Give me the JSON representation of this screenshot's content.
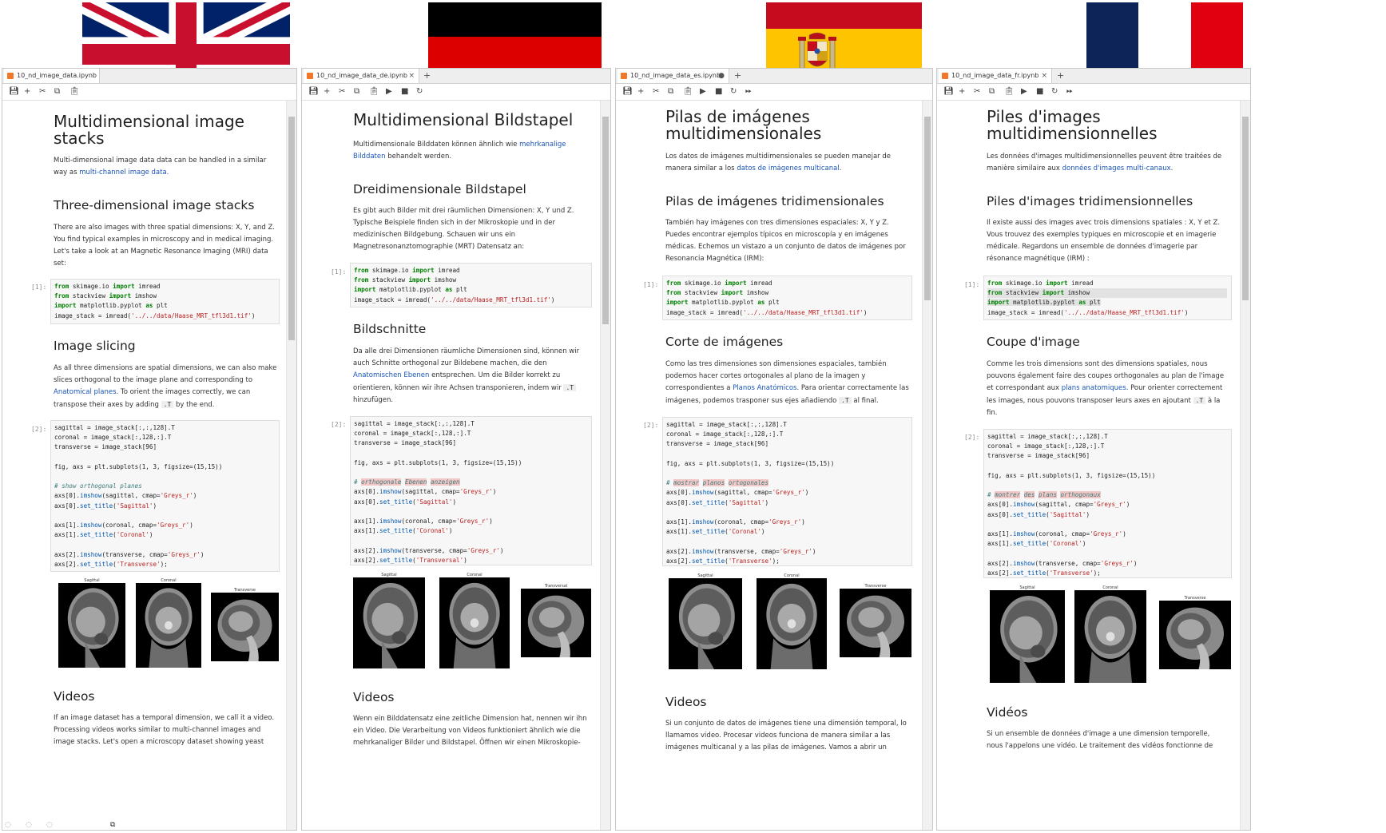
{
  "panels": {
    "en": {
      "tab_title": "10_nd_image_data.ipynb",
      "title": "Multidimensional image stacks",
      "intro": [
        "Multi-dimensional image data data can be handled in a similar",
        "way as "
      ],
      "intro_link": "multi-channel image data.",
      "h_3d": "Three-dimensional image stacks",
      "p_3d": [
        "There are also images with three spatial dimensions: X, Y, and Z.",
        "You find typical examples in microscopy and in medical imaging.",
        "Let's take a look at an Magnetic Resonance Imaging (MRI) data",
        "set:"
      ],
      "prompt1": "[1]:",
      "h_slicing": "Image slicing",
      "p_slicing": [
        "As all three dimensions are spatial dimensions, we can also make",
        "slices orthogonal to the image plane and corresponding to"
      ],
      "p_slicing_link": "Anatomical planes",
      "p_slicing_after": ". To orient the images correctly, we can",
      "p_slicing_end_pre": "transpose their axes by adding ",
      "p_slicing_code": ".T",
      "p_slicing_end_post": " by the end.",
      "prompt2": "[2]:",
      "comment": "# show orthogonal planes",
      "titles": [
        "Sagittal",
        "Coronal",
        "Transverse"
      ],
      "h_videos": "Videos",
      "p_videos": [
        "If an image dataset has a temporal dimension, we call it a video.",
        "Processing videos works similar to multi-channel images and",
        "image stacks. Let's open a microscopy dataset showing yeast"
      ]
    },
    "de": {
      "tab_title": "10_nd_image_data_de.ipynb",
      "title": "Multidimensional Bildstapel",
      "intro": [
        "Multidimensionale Bilddaten können ähnlich wie "
      ],
      "intro_link": "mehrkanalige",
      "intro_link2": "Bilddaten",
      "intro_end": " behandelt werden.",
      "h_3d": "Dreidimensionale Bildstapel",
      "p_3d": [
        "Es gibt auch Bilder mit drei räumlichen Dimensionen: X, Y und Z.",
        "Typische Beispiele finden sich in der Mikroskopie und in der",
        "medizinischen Bildgebung. Schauen wir uns ein",
        "Magnetresonanztomographie (MRT) Datensatz an:"
      ],
      "prompt1": "[1]:",
      "h_slicing": "Bildschnitte",
      "p_slicing": [
        "Da alle drei Dimensionen räumliche Dimensionen sind, können wir",
        "auch Schnitte orthogonal zur Bildebene machen, die den"
      ],
      "p_slicing_link": "Anatomischen Ebenen",
      "p_slicing_after": " entsprechen. Um die Bilder korrekt zu",
      "p_slicing_line4_pre": "orientieren, können wir ihre Achsen transponieren, indem wir ",
      "p_slicing_code": ".T",
      "p_slicing_end": "hinzufügen.",
      "prompt2": "[2]:",
      "comment_words": [
        "orthogonale",
        "Ebenen",
        "anzeigen"
      ],
      "titles": [
        "Sagittal",
        "Coronal",
        "Transversal"
      ],
      "h_videos": "Videos",
      "p_videos": [
        "Wenn ein Bilddatensatz eine zeitliche Dimension hat, nennen wir ihn",
        "ein Video. Die Verarbeitung von Videos funktioniert ähnlich wie die",
        "mehrkanaliger Bilder und Bildstapel. Öffnen wir einen Mikroskopie-"
      ]
    },
    "es": {
      "tab_title": "10_nd_image_data_es.ipynb",
      "title": [
        "Pilas de imágenes",
        "multidimensionales"
      ],
      "intro": [
        "Los datos de imágenes multidimensionales se pueden manejar de",
        "manera similar a los "
      ],
      "intro_link": "datos de imágenes multicanal",
      "intro_end": ".",
      "h_3d": "Pilas de imágenes tridimensionales",
      "p_3d": [
        "También hay imágenes con tres dimensiones espaciales: X, Y y Z.",
        "Puedes encontrar ejemplos típicos en microscopía y en imágenes",
        "médicas. Echemos un vistazo a un conjunto de datos de imágenes por",
        "Resonancia Magnética (IRM):"
      ],
      "prompt1": "[1]:",
      "h_slicing": "Corte de imágenes",
      "p_slicing": [
        "Como las tres dimensiones son dimensiones espaciales, también",
        "podemos hacer cortes ortogonales al plano de la imagen y"
      ],
      "p_slicing_pre": "correspondientes a ",
      "p_slicing_link": "Planos Anatómicos",
      "p_slicing_after": ". Para orientar correctamente las",
      "p_slicing_line4_pre": "imágenes, podemos trasponer sus ejes añadiendo ",
      "p_slicing_code": ".T",
      "p_slicing_line4_post": " al final.",
      "prompt2": "[2]:",
      "comment_words": [
        "mostrar",
        "planos",
        "ortogonales"
      ],
      "titles": [
        "Sagittal",
        "Coronal",
        "Transverse"
      ],
      "h_videos": "Videos",
      "p_videos": [
        "Si un conjunto de datos de imágenes tiene una dimensión temporal, lo",
        "llamamos video. Procesar videos funciona de manera similar a las",
        "imágenes multicanal y a las pilas de imágenes. Vamos a abrir un"
      ]
    },
    "fr": {
      "tab_title": "10_nd_image_data_fr.ipynb",
      "title": [
        "Piles d'images",
        "multidimensionnelles"
      ],
      "intro": [
        "Les données d'images multidimensionnelles peuvent être traitées de",
        "manière similaire aux "
      ],
      "intro_link": "données d'images multi-canaux",
      "intro_end": ".",
      "h_3d": "Piles d'images tridimensionnelles",
      "p_3d": [
        "Il existe aussi des images avec trois dimensions spatiales : X, Y et Z.",
        "Vous trouvez des exemples typiques en microscopie et en imagerie",
        "médicale. Regardons un ensemble de données d'imagerie par",
        "résonance magnétique (IRM) :"
      ],
      "prompt1": "[1]:",
      "h_slicing": "Coupe d'image",
      "p_slicing": [
        "Comme les trois dimensions sont des dimensions spatiales, nous",
        "pouvons également faire des coupes orthogonales au plan de l'image"
      ],
      "p_slicing_pre": "et correspondant aux ",
      "p_slicing_link": "plans anatomiques",
      "p_slicing_after": ". Pour orienter correctement",
      "p_slicing_line4_pre": "les images, nous pouvons transposer leurs axes en ajoutant ",
      "p_slicing_code": ".T",
      "p_slicing_line4_post": " à la",
      "p_slicing_end": "fin.",
      "prompt2": "[2]:",
      "comment_words": [
        "montrer",
        "des",
        "plans",
        "orthogonaux"
      ],
      "titles": [
        "Sagittal",
        "Coronal",
        "Transverse"
      ],
      "h_videos": "Vidéos",
      "p_videos": [
        "Si un ensemble de données d'image a une dimension temporelle,",
        "nous l'appelons une vidéo. Le traitement des vidéos fonctionne de"
      ]
    }
  },
  "code": {
    "c1_l1": [
      "from",
      " skimage.io ",
      "import",
      " imread"
    ],
    "c1_l2": [
      "from",
      " stackview ",
      "import",
      " imshow"
    ],
    "c1_l3": [
      "import",
      " matplotlib.pyplot ",
      "as",
      " plt"
    ],
    "c1_l4": [
      "image_stack = imread(",
      "'../../data/Haase_MRT_tfl3d1.tif'",
      ")"
    ],
    "c2_sag": "sagittal = image_stack[:,:,128].T",
    "c2_cor": "coronal = image_stack[:,128,:].T",
    "c2_tra": "transverse = image_stack[96]",
    "c2_fig": [
      "fig, axs = plt.subplots(1, 3, figsize=(15,15))"
    ],
    "c2_a0": [
      "axs[0].",
      "imshow",
      "(sagittal, cmap=",
      "'Greys_r'",
      ")"
    ],
    "c2_a0t": [
      "axs[0].",
      "set_title",
      "(",
      "'Sagittal'",
      ")"
    ],
    "c2_a1": [
      "axs[1].",
      "imshow",
      "(coronal, cmap=",
      "'Greys_r'",
      ")"
    ],
    "c2_a1t": [
      "axs[1].",
      "set_title",
      "(",
      "'Coronal'",
      ")"
    ],
    "c2_a2": [
      "axs[2].",
      "imshow",
      "(transverse, cmap=",
      "'Greys_r'",
      ")"
    ],
    "c2_a2t": [
      "axs[2].",
      "set_title",
      "(",
      "'Transverse'",
      ");"
    ],
    "c2_a2t_de": [
      "axs[2].",
      "set_title",
      "(",
      "'Transversal'",
      ")"
    ]
  },
  "colors": {
    "uk_blue": "#012169",
    "uk_red": "#c8102e",
    "de_black": "#000000",
    "de_red": "#dd0000",
    "de_gold": "#ffce00",
    "es_red": "#c60b1e",
    "es_yellow": "#ffc400",
    "fr_blue": "#0d2458",
    "fr_red": "#e1000f"
  }
}
